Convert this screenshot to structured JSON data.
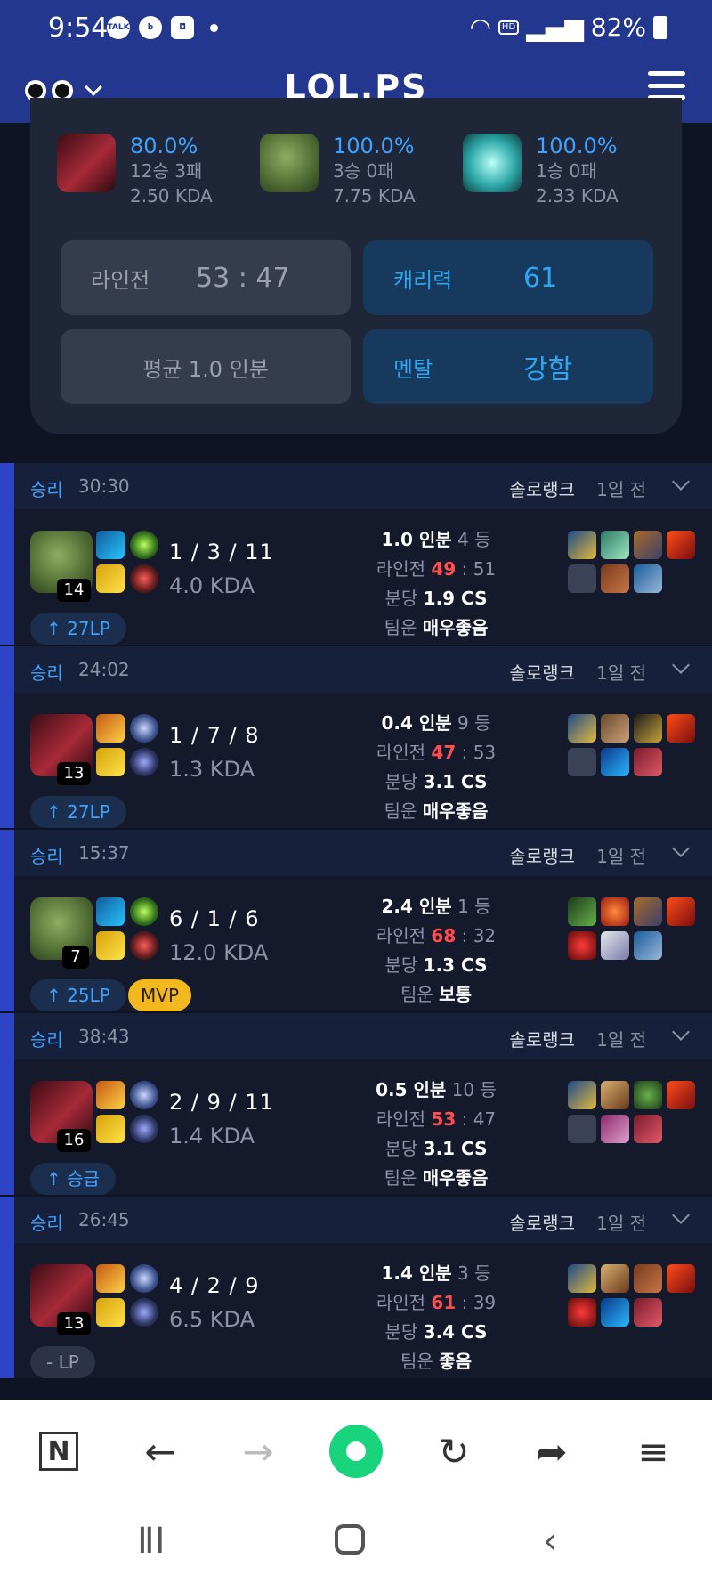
{
  "status": {
    "time": "9:54",
    "app_icons": [
      "TALK",
      "b",
      "◘"
    ],
    "hd": "HD",
    "battery": "82%"
  },
  "header": {
    "logo": "LOL.PS"
  },
  "summary": {
    "champs": [
      {
        "winrate": "80.0%",
        "record": "12승 3패",
        "kda": "2.50 KDA",
        "color": "#7a1e2a"
      },
      {
        "winrate": "100.0%",
        "record": "3승 0패",
        "kda": "7.75 KDA",
        "color": "#5b7a3a"
      },
      {
        "winrate": "100.0%",
        "record": "1승 0패",
        "kda": "2.33 KDA",
        "color": "#2ea9a8"
      }
    ],
    "lane_label": "라인전",
    "lane_value": "53 : 47",
    "carry_label": "캐리력",
    "carry_value": "61",
    "avg_text": "평균 1.0 인분",
    "mental_label": "멘탈",
    "mental_value": "강함"
  },
  "matches": [
    {
      "result": "승리",
      "duration": "30:30",
      "queue": "솔로랭크",
      "ago": "1일 전",
      "level": "14",
      "kda": "1 / 3 / 11",
      "kda_ratio": "4.0 KDA",
      "lp": "↑ 27LP",
      "mvp": "",
      "perf": "1.0 인분",
      "rank": "4 등",
      "lane_label": "라인전",
      "lane_a": "49",
      "lane_b": "51",
      "cs_label": "분당",
      "cs": "1.9 CS",
      "luck_label": "팀운",
      "luck": "매우좋음"
    },
    {
      "result": "승리",
      "duration": "24:02",
      "queue": "솔로랭크",
      "ago": "1일 전",
      "level": "13",
      "kda": "1 / 7 / 8",
      "kda_ratio": "1.3 KDA",
      "lp": "↑ 27LP",
      "mvp": "",
      "perf": "0.4 인분",
      "rank": "9 등",
      "lane_label": "라인전",
      "lane_a": "47",
      "lane_b": "53",
      "cs_label": "분당",
      "cs": "3.1 CS",
      "luck_label": "팀운",
      "luck": "매우좋음"
    },
    {
      "result": "승리",
      "duration": "15:37",
      "queue": "솔로랭크",
      "ago": "1일 전",
      "level": "7",
      "kda": "6 / 1 / 6",
      "kda_ratio": "12.0 KDA",
      "lp": "↑ 25LP",
      "mvp": "MVP",
      "perf": "2.4 인분",
      "rank": "1 등",
      "lane_label": "라인전",
      "lane_a": "68",
      "lane_b": "32",
      "cs_label": "분당",
      "cs": "1.3 CS",
      "luck_label": "팀운",
      "luck": "보통"
    },
    {
      "result": "승리",
      "duration": "38:43",
      "queue": "솔로랭크",
      "ago": "1일 전",
      "level": "16",
      "kda": "2 / 9 / 11",
      "kda_ratio": "1.4 KDA",
      "lp": "↑ 승급",
      "mvp": "",
      "perf": "0.5 인분",
      "rank": "10 등",
      "lane_label": "라인전",
      "lane_a": "53",
      "lane_b": "47",
      "cs_label": "분당",
      "cs": "3.1 CS",
      "luck_label": "팀운",
      "luck": "매우좋음"
    },
    {
      "result": "승리",
      "duration": "26:45",
      "queue": "솔로랭크",
      "ago": "1일 전",
      "level": "13",
      "kda": "4 / 2 / 9",
      "kda_ratio": "6.5 KDA",
      "lp": "- LP",
      "mvp": "",
      "perf": "1.4 인분",
      "rank": "3 등",
      "lane_label": "라인전",
      "lane_a": "61",
      "lane_b": "39",
      "cs_label": "분당",
      "cs": "3.4 CS",
      "luck_label": "팀운",
      "luck": "좋음"
    }
  ],
  "browser": {
    "n_label": "N"
  },
  "colors": {
    "header": "#23378f",
    "accent": "#3ea2ff",
    "mvp": "#f2b81e",
    "win_bar": "#2d44c7"
  }
}
